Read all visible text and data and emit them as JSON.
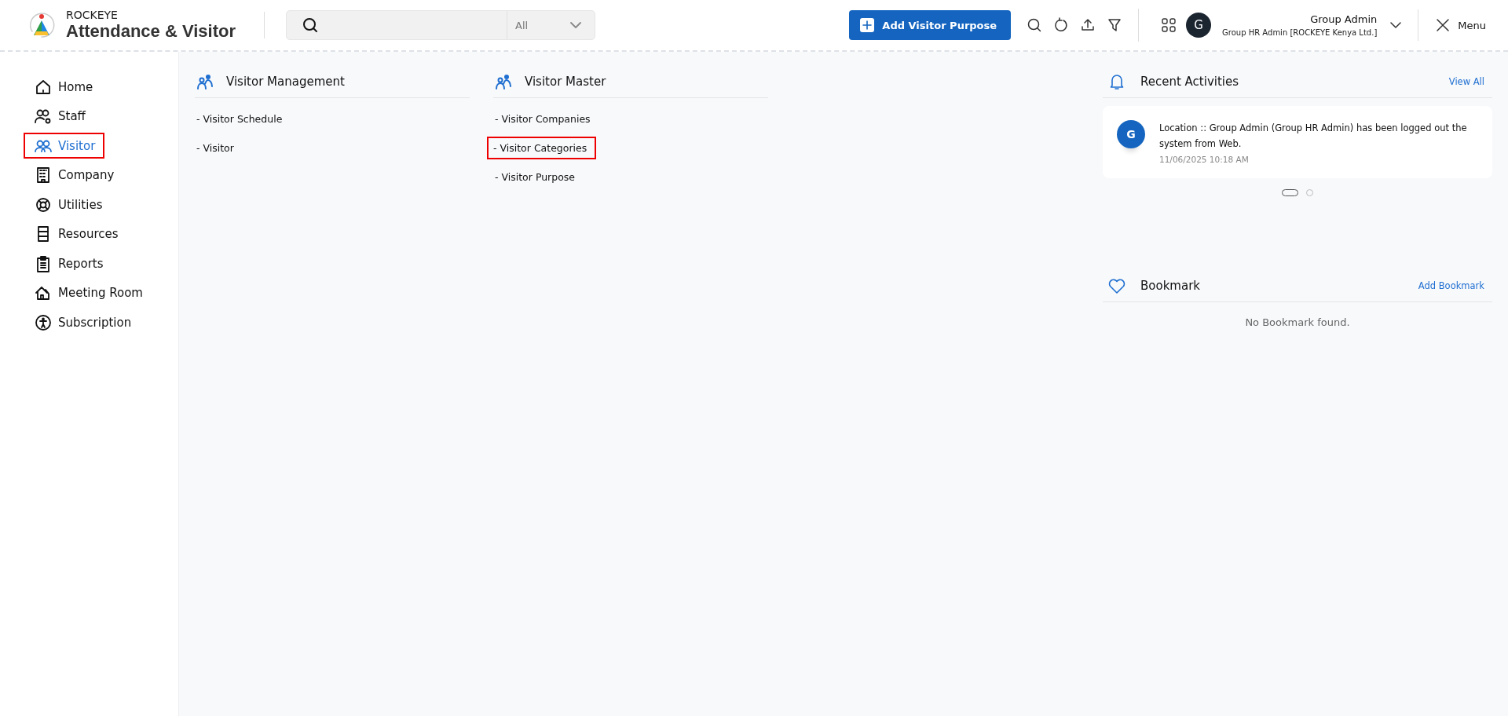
{
  "header": {
    "brand": "ROCKEYE",
    "app_title": "Attendance & Visitor",
    "search": {
      "scope": "All"
    },
    "add_button": "Add Visitor Purpose",
    "user": {
      "initial": "G",
      "name": "Group Admin",
      "role": "Group HR Admin [ROCKEYE Kenya Ltd.]"
    },
    "menu_label": "Menu"
  },
  "sidebar": {
    "items": [
      {
        "label": "Home",
        "selected": false,
        "highlighted": false
      },
      {
        "label": "Staff",
        "selected": false,
        "highlighted": false
      },
      {
        "label": "Visitor",
        "selected": true,
        "highlighted": true
      },
      {
        "label": "Company",
        "selected": false,
        "highlighted": false
      },
      {
        "label": "Utilities",
        "selected": false,
        "highlighted": false
      },
      {
        "label": "Resources",
        "selected": false,
        "highlighted": false
      },
      {
        "label": "Reports",
        "selected": false,
        "highlighted": false
      },
      {
        "label": "Meeting Room",
        "selected": false,
        "highlighted": false
      },
      {
        "label": "Subscription",
        "selected": false,
        "highlighted": false
      }
    ]
  },
  "sections": [
    {
      "title": "Visitor Management",
      "links": [
        {
          "label": "- Visitor Schedule",
          "highlighted": false
        },
        {
          "label": "- Visitor",
          "highlighted": false
        }
      ]
    },
    {
      "title": "Visitor Master",
      "links": [
        {
          "label": "- Visitor Companies",
          "highlighted": false
        },
        {
          "label": "- Visitor Categories",
          "highlighted": true
        },
        {
          "label": "- Visitor Purpose",
          "highlighted": false
        }
      ]
    }
  ],
  "recent_activities": {
    "title": "Recent Activities",
    "view_all": "View All",
    "items": [
      {
        "initial": "G",
        "message": "Location :: Group Admin (Group HR Admin) has been logged out the system from Web.",
        "time": "11/06/2025 10:18 AM"
      }
    ],
    "pager": [
      {
        "selected": true
      },
      {
        "selected": false
      }
    ]
  },
  "bookmark": {
    "title": "Bookmark",
    "add_label": "Add Bookmark",
    "empty_text": "No Bookmark found."
  }
}
